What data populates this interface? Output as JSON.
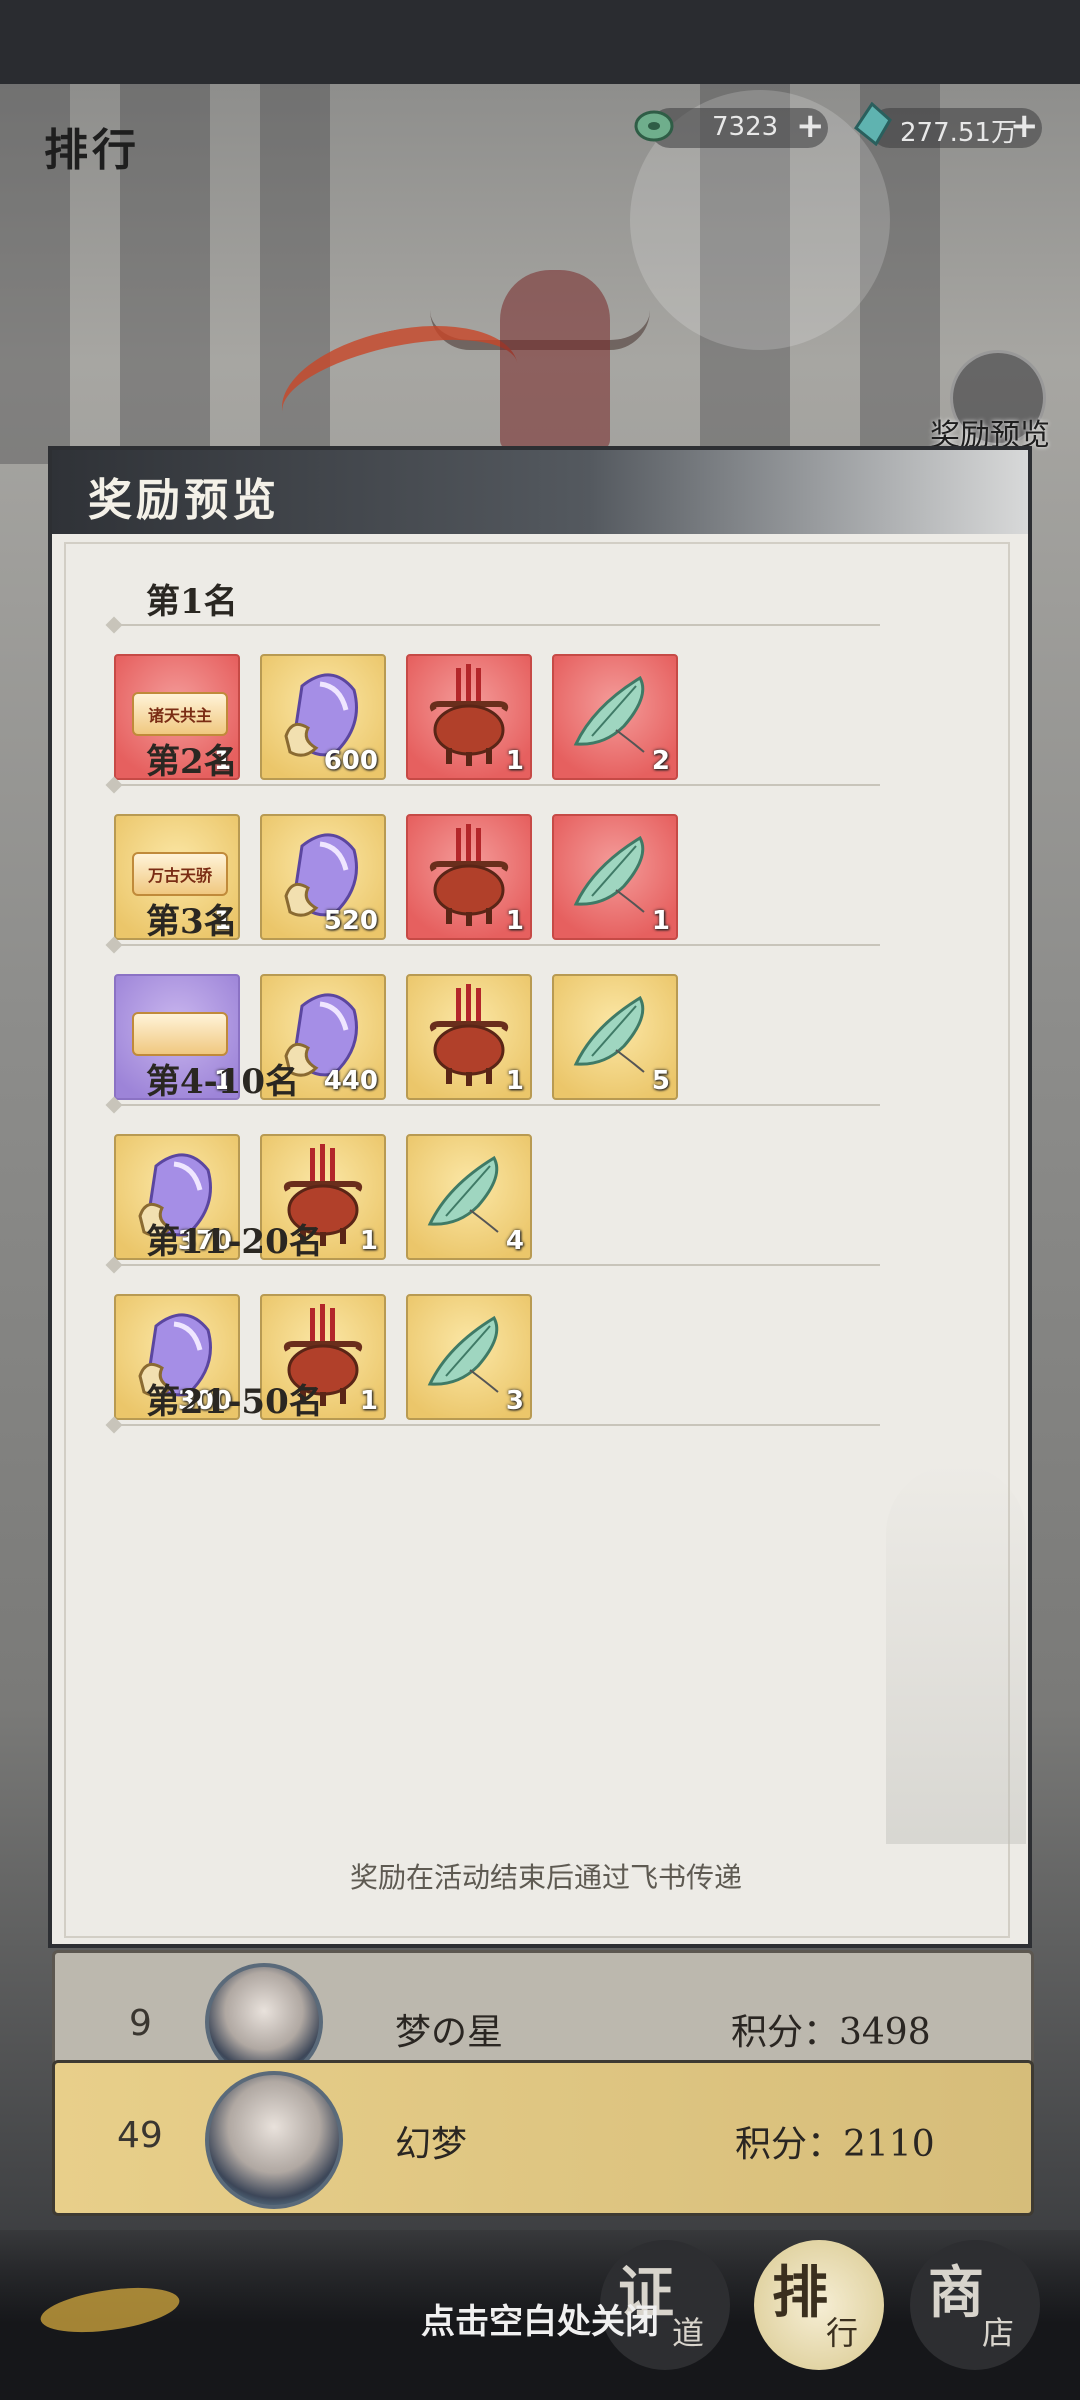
{
  "screen": {
    "title": "排行"
  },
  "currency": [
    {
      "icon": "jade-coin-icon",
      "value": "7323"
    },
    {
      "icon": "spirit-stone-icon",
      "value": "277.51万"
    }
  ],
  "reward_preview_button": {
    "label": "奖励预览"
  },
  "modal": {
    "title": "奖励预览",
    "footer": "奖励在活动结束后通过飞书传递",
    "tiers": [
      {
        "label": "第1名",
        "items": [
          {
            "icon": "title-plaque-icon",
            "plaque": "诸天共主",
            "rarity": "red",
            "count": "1"
          },
          {
            "icon": "purple-gem-icon",
            "rarity": "gold",
            "count": "600"
          },
          {
            "icon": "incense-burner-icon",
            "rarity": "red",
            "count": "1"
          },
          {
            "icon": "jade-cicada-icon",
            "rarity": "red",
            "count": "2"
          }
        ]
      },
      {
        "label": "第2名",
        "items": [
          {
            "icon": "title-plaque-icon",
            "plaque": "万古天骄",
            "rarity": "gold",
            "count": "1"
          },
          {
            "icon": "purple-gem-icon",
            "rarity": "gold",
            "count": "520"
          },
          {
            "icon": "incense-burner-icon",
            "rarity": "red",
            "count": "1"
          },
          {
            "icon": "jade-cicada-icon",
            "rarity": "red",
            "count": "1"
          }
        ]
      },
      {
        "label": "第3名",
        "items": [
          {
            "icon": "title-plaque-icon",
            "plaque": "",
            "rarity": "purple",
            "count": "1"
          },
          {
            "icon": "purple-gem-icon",
            "rarity": "gold",
            "count": "440"
          },
          {
            "icon": "incense-burner-icon",
            "rarity": "gold",
            "count": "1"
          },
          {
            "icon": "jade-cicada-icon",
            "rarity": "gold",
            "count": "5"
          }
        ]
      },
      {
        "label": "第4-10名",
        "items": [
          {
            "icon": "purple-gem-icon",
            "rarity": "gold",
            "count": "370"
          },
          {
            "icon": "incense-burner-icon",
            "rarity": "gold",
            "count": "1"
          },
          {
            "icon": "jade-cicada-icon",
            "rarity": "gold",
            "count": "4"
          }
        ]
      },
      {
        "label": "第11-20名",
        "items": [
          {
            "icon": "purple-gem-icon",
            "rarity": "gold",
            "count": "300"
          },
          {
            "icon": "incense-burner-icon",
            "rarity": "gold",
            "count": "1"
          },
          {
            "icon": "jade-cicada-icon",
            "rarity": "gold",
            "count": "3"
          }
        ]
      },
      {
        "label": "第21-50名",
        "items": []
      }
    ]
  },
  "leaderboard": {
    "row": {
      "rank": "9",
      "name": "梦の星",
      "score": "积分：3498"
    },
    "mine": {
      "rank": "49",
      "name": "幻梦",
      "score": "积分：2110"
    }
  },
  "bottom_nav": [
    {
      "big": "证",
      "small": "道",
      "active": false
    },
    {
      "big": "排",
      "small": "行",
      "active": true
    },
    {
      "big": "商",
      "small": "店",
      "active": false
    }
  ],
  "close_hint": "点击空白处关闭",
  "colors": {
    "red_rarity": "#e6605f",
    "gold_rarity": "#ebc66a",
    "purple_rarity": "#9d84d8",
    "modal_bg": "#edebe6"
  }
}
